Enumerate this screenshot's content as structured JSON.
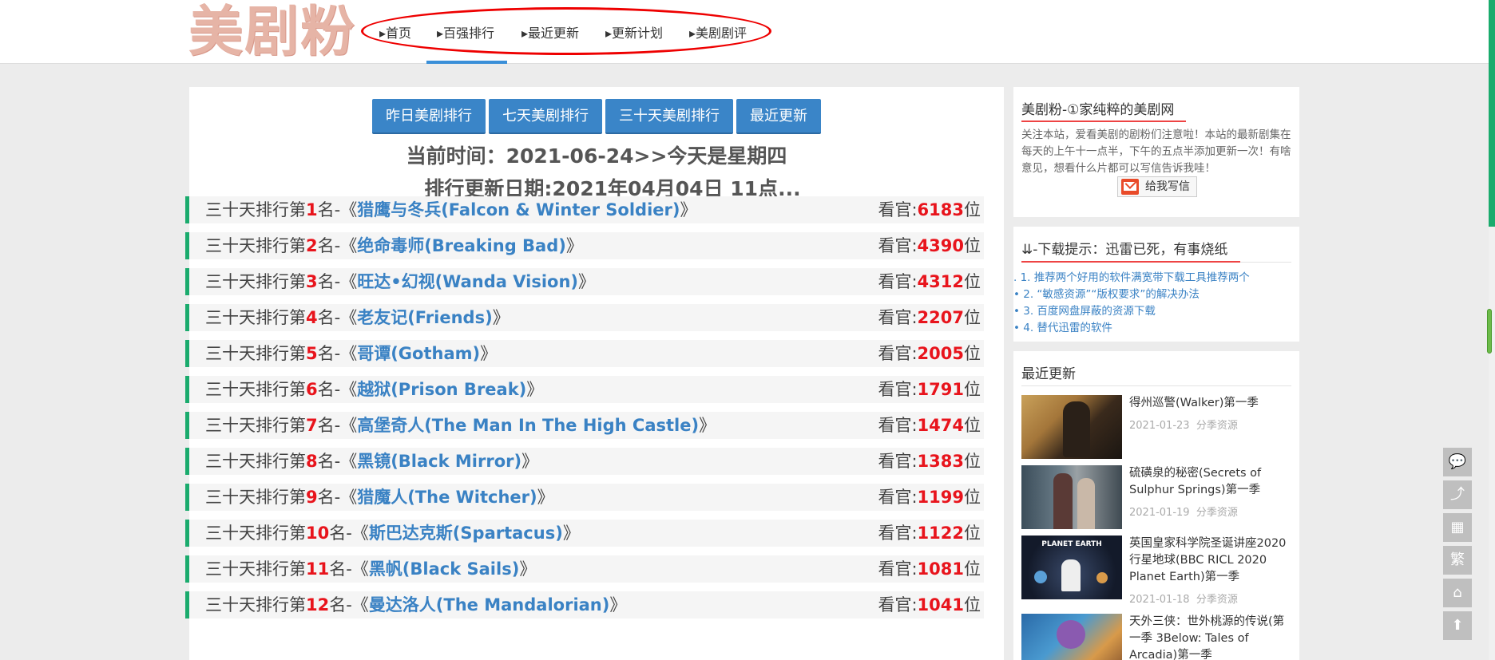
{
  "logo": {
    "text": "美剧粉"
  },
  "nav": [
    {
      "label": "▸首页"
    },
    {
      "label": "▸百强排行"
    },
    {
      "label": "▸最近更新"
    },
    {
      "label": "▸更新计划"
    },
    {
      "label": "▸美剧剧评"
    }
  ],
  "tabs": [
    {
      "label": "昨日美剧排行"
    },
    {
      "label": "七天美剧排行"
    },
    {
      "label": "三十天美剧排行"
    },
    {
      "label": "最近更新"
    }
  ],
  "current_time": "当前时间：2021-06-24>>今天是星期四",
  "update_date": "排行更新日期:2021年04月04日 11点...",
  "rankings": [
    {
      "prefix": "三十天排行第",
      "rank": "1",
      "mid": "名-《",
      "title": "猎鹰与冬兵(Falcon & Winter Soldier)",
      "suffix": "》",
      "viewer_label": "看官:",
      "views": "6183",
      "unit": "位"
    },
    {
      "prefix": "三十天排行第",
      "rank": "2",
      "mid": "名-《",
      "title": "绝命毒师(Breaking Bad)",
      "suffix": "》",
      "viewer_label": "看官:",
      "views": "4390",
      "unit": "位"
    },
    {
      "prefix": "三十天排行第",
      "rank": "3",
      "mid": "名-《",
      "title": "旺达•幻视(Wanda Vision)",
      "suffix": "》",
      "viewer_label": "看官:",
      "views": "4312",
      "unit": "位"
    },
    {
      "prefix": "三十天排行第",
      "rank": "4",
      "mid": "名-《",
      "title": "老友记(Friends)",
      "suffix": "》",
      "viewer_label": "看官:",
      "views": "2207",
      "unit": "位"
    },
    {
      "prefix": "三十天排行第",
      "rank": "5",
      "mid": "名-《",
      "title": "哥谭(Gotham)",
      "suffix": "》",
      "viewer_label": "看官:",
      "views": "2005",
      "unit": "位"
    },
    {
      "prefix": "三十天排行第",
      "rank": "6",
      "mid": "名-《",
      "title": "越狱(Prison Break)",
      "suffix": "》",
      "viewer_label": "看官:",
      "views": "1791",
      "unit": "位"
    },
    {
      "prefix": "三十天排行第",
      "rank": "7",
      "mid": "名-《",
      "title": "高堡奇人(The Man In The High Castle)",
      "suffix": "》",
      "viewer_label": "看官:",
      "views": "1474",
      "unit": "位"
    },
    {
      "prefix": "三十天排行第",
      "rank": "8",
      "mid": "名-《",
      "title": "黑镜(Black Mirror)",
      "suffix": "》",
      "viewer_label": "看官:",
      "views": "1383",
      "unit": "位"
    },
    {
      "prefix": "三十天排行第",
      "rank": "9",
      "mid": "名-《",
      "title": "猎魔人(The Witcher)",
      "suffix": "》",
      "viewer_label": "看官:",
      "views": "1199",
      "unit": "位"
    },
    {
      "prefix": "三十天排行第",
      "rank": "10",
      "mid": "名-《",
      "title": "斯巴达克斯(Spartacus)",
      "suffix": "》",
      "viewer_label": "看官:",
      "views": "1122",
      "unit": "位"
    },
    {
      "prefix": "三十天排行第",
      "rank": "11",
      "mid": "名-《",
      "title": "黑帆(Black Sails)",
      "suffix": "》",
      "viewer_label": "看官:",
      "views": "1081",
      "unit": "位"
    },
    {
      "prefix": "三十天排行第",
      "rank": "12",
      "mid": "名-《",
      "title": "曼达洛人(The Mandalorian)",
      "suffix": "》",
      "viewer_label": "看官:",
      "views": "1041",
      "unit": "位"
    }
  ],
  "sidebar": {
    "about": {
      "title": "美剧粉-①家纯粹的美剧网",
      "text": "关注本站，爱看美剧的剧粉们注意啦！本站的最新剧集在每天的上午十一点半，下午的五点半添加更新一次！有啥意见，想看什么片都可以写信告诉我哇！",
      "button": "给我写信"
    },
    "download": {
      "title": "⇊-下载提示：迅雷已死，有事烧纸",
      "items": [
        ". 1. 推荐两个好用的软件满宽带下载工具推荐两个",
        "• 2. “敏感资源”“版权要求”的解决办法",
        "• 3. 百度网盘屏蔽的资源下载",
        "• 4. 替代迅雷的软件"
      ]
    },
    "recent": {
      "title": "最近更新",
      "items": [
        {
          "title": "得州巡警(Walker)第一季",
          "date": "2021-01-23",
          "category": "分季资源"
        },
        {
          "title": "硫磺泉的秘密(Secrets of Sulphur Springs)第一季",
          "date": "2021-01-19",
          "category": "分季资源"
        },
        {
          "title": "英国皇家科学院圣诞讲座2020行星地球(BBC RICL 2020 Planet Earth)第一季",
          "date": "2021-01-18",
          "category": "分季资源"
        },
        {
          "title": "天外三侠：世外桃源的传说(第一季 3Below: Tales of Arcadia)第一季",
          "date": "",
          "category": ""
        }
      ],
      "thumb_text_3": "PLANET EARTH"
    }
  },
  "float_toolbar": [
    {
      "icon": "comment-icon",
      "glyph": "💬"
    },
    {
      "icon": "share-icon",
      "glyph": "⤴"
    },
    {
      "icon": "qrcode-icon",
      "glyph": "▦"
    },
    {
      "icon": "traditional-chinese-icon",
      "glyph": "繁"
    },
    {
      "icon": "home-icon",
      "glyph": "⌂"
    },
    {
      "icon": "back-to-top-icon",
      "glyph": "⬆"
    }
  ],
  "colors": {
    "accent": "#3a85c8",
    "rank_red": "#e8141c",
    "row_border": "#1aab6d",
    "title_blue": "#3a82c4"
  }
}
